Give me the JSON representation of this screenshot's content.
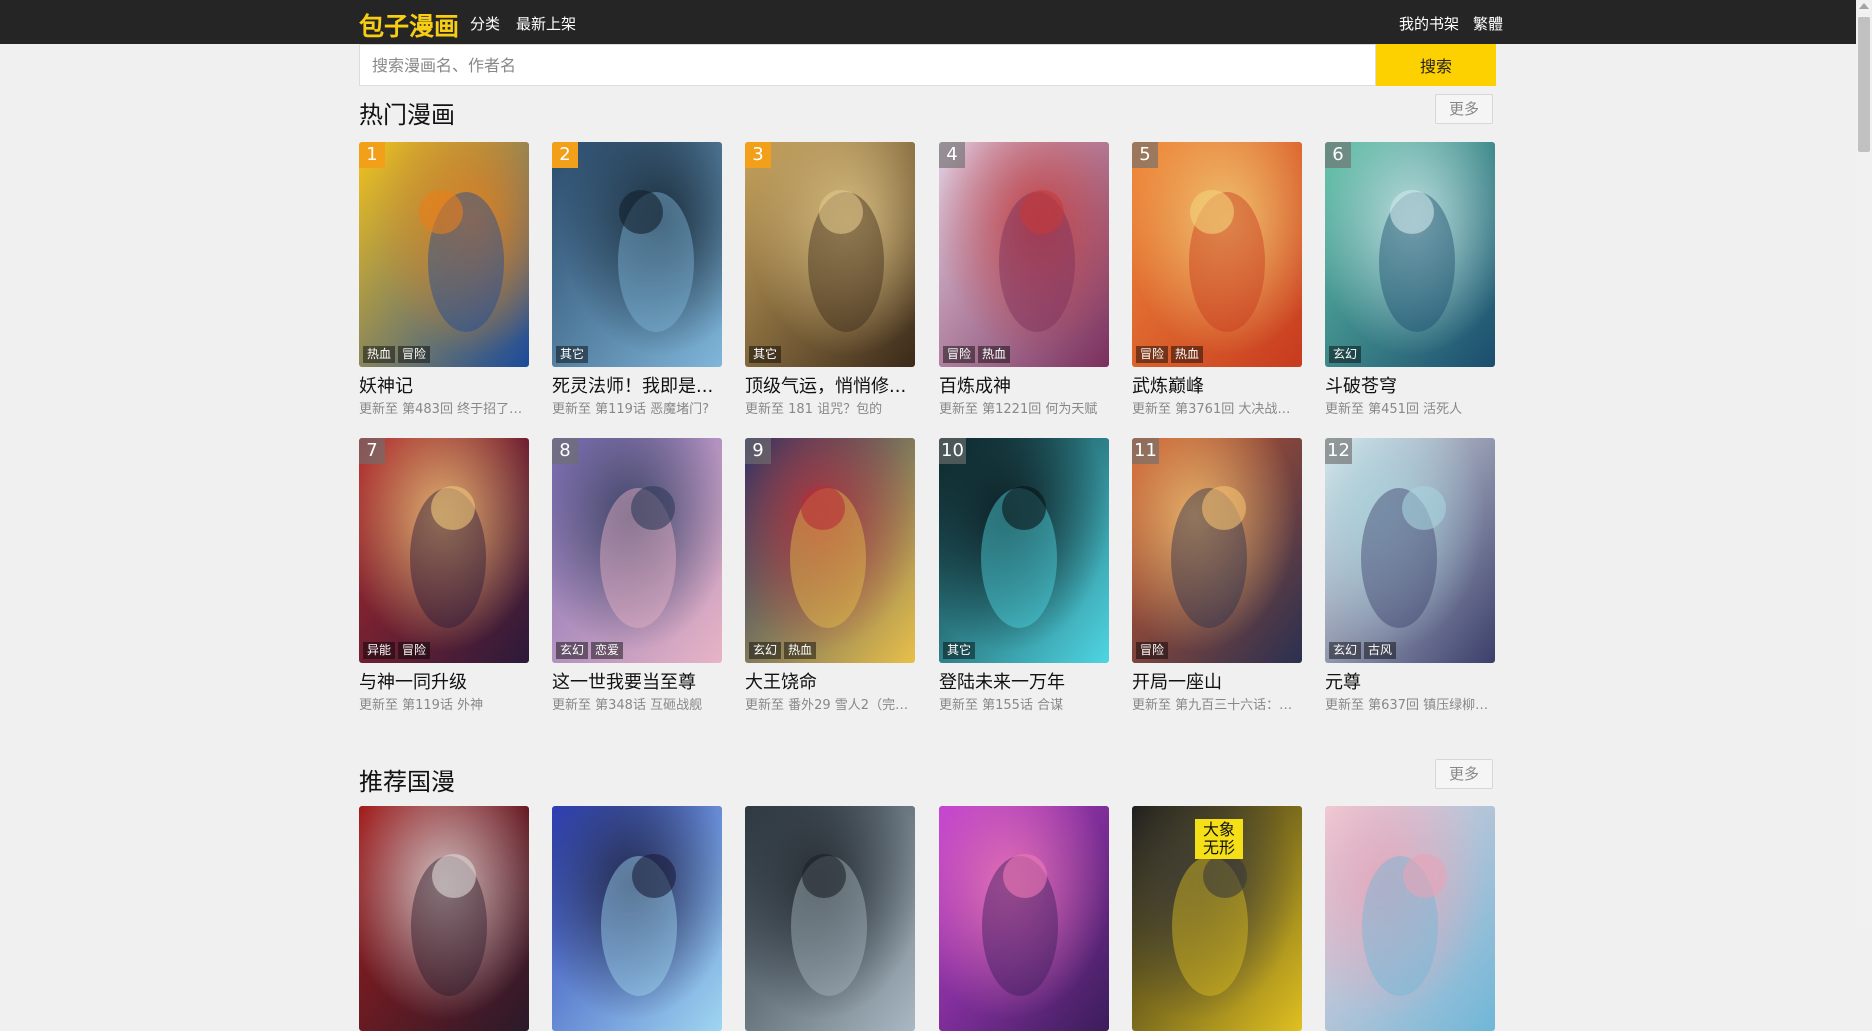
{
  "header": {
    "logo": "包子漫画",
    "nav": [
      "分类",
      "最新上架"
    ],
    "bookshelf": "我的书架",
    "traditional": "繁體"
  },
  "search": {
    "placeholder": "搜索漫画名、作者名",
    "button": "搜索"
  },
  "hot": {
    "title": "热门漫画",
    "more": "更多",
    "items": [
      {
        "rank": "1",
        "title": "妖神记",
        "update": "更新至 第483回 终于招了（...",
        "tags": [
          "热血",
          "冒险"
        ],
        "palette": [
          "#f6c21a",
          "#1b4a9c",
          "#e77f1a"
        ]
      },
      {
        "rank": "2",
        "title": "死灵法师！我即是...",
        "update": "更新至 第119话 恶魔堵门?",
        "tags": [
          "其它"
        ],
        "palette": [
          "#2a4a6b",
          "#7fb6d9",
          "#12202c"
        ]
      },
      {
        "rank": "3",
        "title": "顶级气运，悄悄修...",
        "update": "更新至 181 诅咒？包的",
        "tags": [
          "其它"
        ],
        "palette": [
          "#c7a35c",
          "#3b2a1a",
          "#e2c88a"
        ]
      },
      {
        "rank": "4",
        "title": "百炼成神",
        "update": "更新至 第1221回 何为天赋",
        "tags": [
          "冒险",
          "热血"
        ],
        "palette": [
          "#e3cfe0",
          "#7a2f5c",
          "#c43a3a"
        ]
      },
      {
        "rank": "5",
        "title": "武炼巅峰",
        "update": "更新至 第3761回 大决战篇-...",
        "tags": [
          "冒险",
          "热血"
        ],
        "palette": [
          "#f08a3a",
          "#c73a1f",
          "#f3d27a"
        ]
      },
      {
        "rank": "6",
        "title": "斗破苍穹",
        "update": "更新至 第451回 活死人",
        "tags": [
          "玄幻"
        ],
        "palette": [
          "#5fc2a6",
          "#1b4d6e",
          "#cfe9ea"
        ]
      },
      {
        "rank": "7",
        "title": "与神一同升级",
        "update": "更新至 第119话 外神",
        "tags": [
          "异能",
          "冒险"
        ],
        "palette": [
          "#b3272a",
          "#2b1a3a",
          "#f0c77a"
        ]
      },
      {
        "rank": "8",
        "title": "这一世我要当至尊",
        "update": "更新至 第348话 互砸战舰",
        "tags": [
          "玄幻",
          "恋爱"
        ],
        "palette": [
          "#7d6fb8",
          "#e8b4c5",
          "#2e3a5a"
        ]
      },
      {
        "rank": "9",
        "title": "大王饶命",
        "update": "更新至 番外29 雪人2（完结...",
        "tags": [
          "玄幻",
          "热血"
        ],
        "palette": [
          "#1a2f6b",
          "#e8c04a",
          "#b52d3a"
        ]
      },
      {
        "rank": "10",
        "title": "登陆未来一万年",
        "update": "更新至 第155话 合谋",
        "tags": [
          "其它"
        ],
        "palette": [
          "#0d2a2f",
          "#4fd6e3",
          "#0a1418"
        ]
      },
      {
        "rank": "11",
        "title": "开局一座山",
        "update": "更新至 第九百三十六话：瓶...",
        "tags": [
          "冒险"
        ],
        "palette": [
          "#d0582a",
          "#2a3050",
          "#f3c070"
        ]
      },
      {
        "rank": "12",
        "title": "元尊",
        "update": "更新至 第637回 镇压绿柳（...",
        "tags": [
          "玄幻",
          "古风"
        ],
        "palette": [
          "#e6f0f3",
          "#3b3f6b",
          "#a7d3dc"
        ]
      }
    ]
  },
  "recommend": {
    "title": "推荐国漫",
    "more": "更多",
    "items": [
      {
        "palette": [
          "#a31c1c",
          "#2a1a2a",
          "#e0d8d8"
        ]
      },
      {
        "palette": [
          "#2d3fb8",
          "#9fd6f0",
          "#1a1d3a"
        ]
      },
      {
        "palette": [
          "#2f3a44",
          "#a9b8c2",
          "#1c2228"
        ]
      },
      {
        "palette": [
          "#c23fd6",
          "#3a1d5a",
          "#f07ab8"
        ]
      },
      {
        "palette": [
          "#1a1a1a",
          "#e0c020",
          "#3a3a3a"
        ],
        "badge": "大象\n无形"
      },
      {
        "palette": [
          "#f3d0d8",
          "#6fb7d8",
          "#e7a3b8"
        ]
      }
    ]
  },
  "colors": {
    "header_bg": "#252525",
    "logo": "#f7ce14",
    "accent": "#fdd000",
    "rank_top": "#f2a01a"
  }
}
